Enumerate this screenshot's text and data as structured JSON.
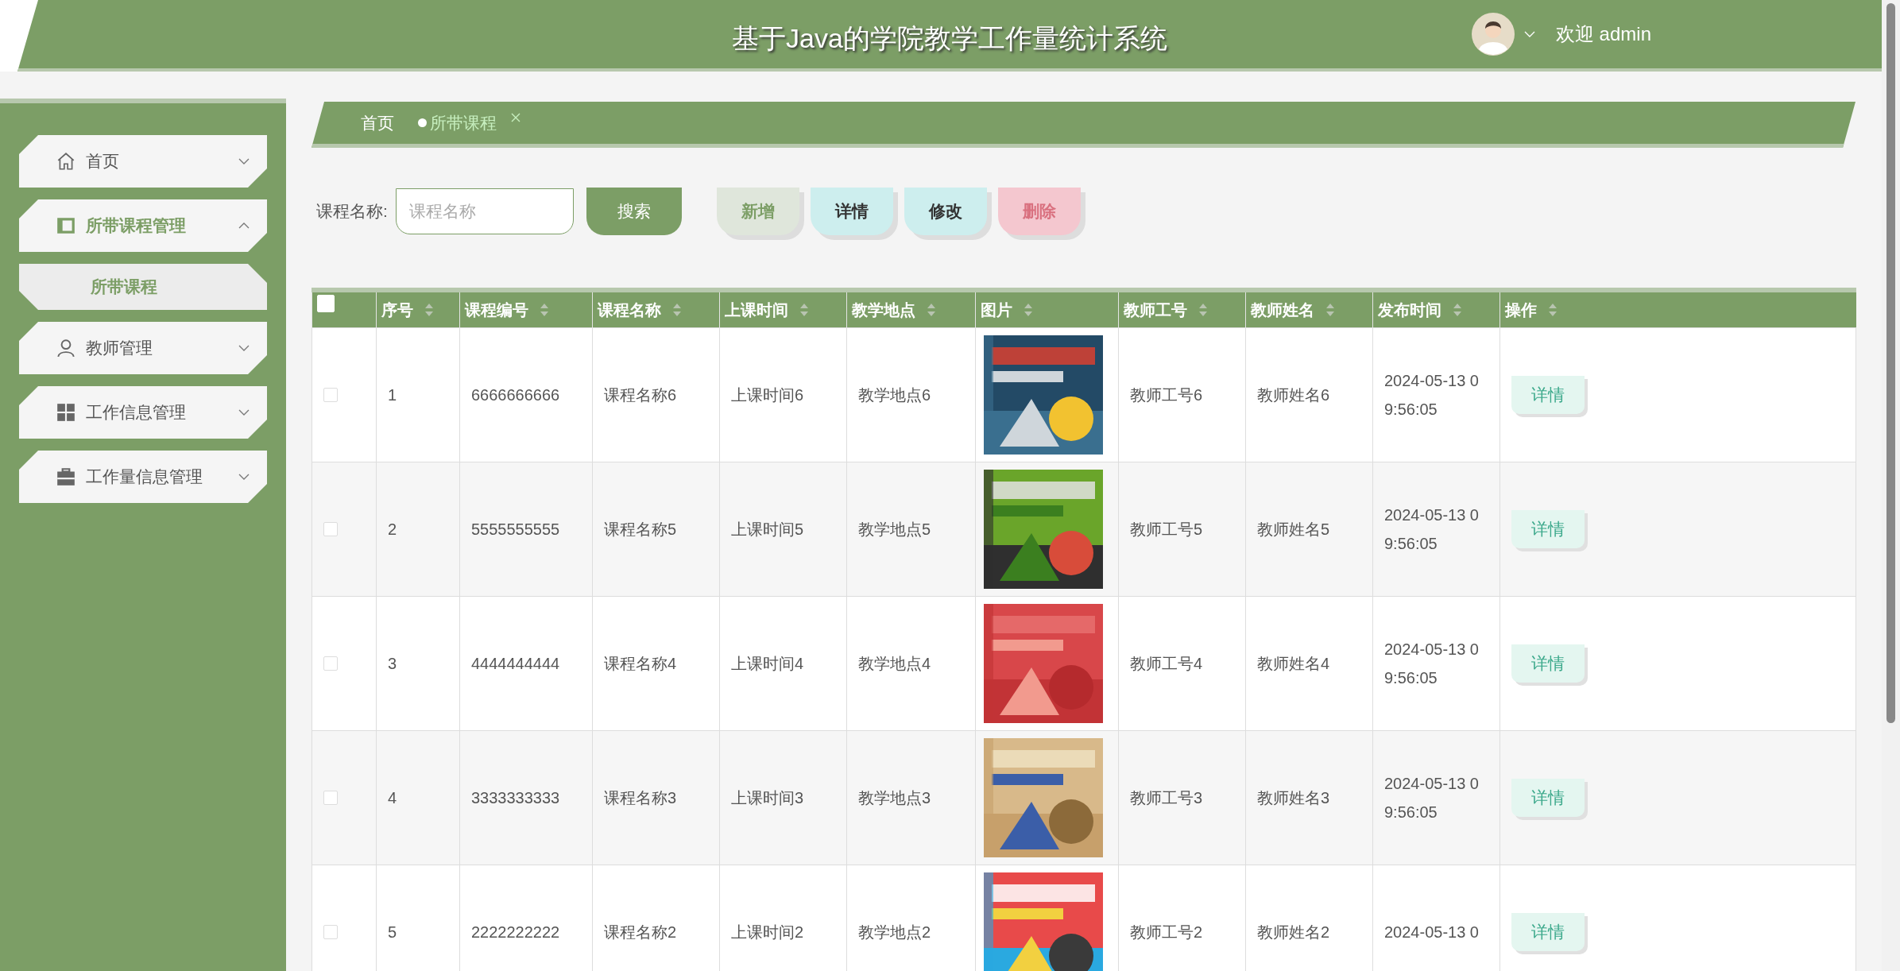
{
  "header": {
    "title": "基于Java的学院教学工作量统计系统",
    "welcome": "欢迎 admin"
  },
  "sidebar": {
    "items": [
      {
        "label": "首页",
        "kind": "home",
        "active": false,
        "expanded": false
      },
      {
        "label": "所带课程管理",
        "kind": "book",
        "active": true,
        "expanded": true,
        "children": [
          {
            "label": "所带课程",
            "selected": true
          }
        ]
      },
      {
        "label": "教师管理",
        "kind": "user",
        "active": false,
        "expanded": false
      },
      {
        "label": "工作信息管理",
        "kind": "grid",
        "active": false,
        "expanded": false
      },
      {
        "label": "工作量信息管理",
        "kind": "briefcase",
        "active": false,
        "expanded": false
      }
    ]
  },
  "tabs": [
    {
      "label": "首页",
      "selected": false,
      "closable": false
    },
    {
      "label": "所带课程",
      "selected": true,
      "closable": true
    }
  ],
  "search": {
    "label": "课程名称:",
    "placeholder": "课程名称",
    "button": "搜索"
  },
  "actions": [
    {
      "label": "新增",
      "kind": "add"
    },
    {
      "label": "详情",
      "kind": "detail"
    },
    {
      "label": "修改",
      "kind": "edit"
    },
    {
      "label": "删除",
      "kind": "delete"
    }
  ],
  "table": {
    "select_all_checked": false,
    "columns": [
      "序号",
      "课程编号",
      "课程名称",
      "上课时间",
      "教学地点",
      "图片",
      "教师工号",
      "教师姓名",
      "发布时间",
      "操作"
    ],
    "rows": [
      {
        "checked": false,
        "cells": [
          "1",
          "6666666666",
          "课程名称6",
          "上课时间6",
          "教学地点6"
        ],
        "picture": {
          "kind": "picture"
        },
        "cells2": [
          "教师工号6",
          "教师姓名6",
          "2024-05-13 09:56:05"
        ],
        "action": "详情"
      },
      {
        "checked": false,
        "cells": [
          "2",
          "5555555555",
          "课程名称5",
          "上课时间5",
          "教学地点5"
        ],
        "picture": {
          "kind": "picture"
        },
        "cells2": [
          "教师工号5",
          "教师姓名5",
          "2024-05-13 09:56:05"
        ],
        "action": "详情"
      },
      {
        "checked": false,
        "cells": [
          "3",
          "4444444444",
          "课程名称4",
          "上课时间4",
          "教学地点4"
        ],
        "picture": {
          "kind": "picture"
        },
        "cells2": [
          "教师工号4",
          "教师姓名4",
          "2024-05-13 09:56:05"
        ],
        "action": "详情"
      },
      {
        "checked": false,
        "cells": [
          "4",
          "3333333333",
          "课程名称3",
          "上课时间3",
          "教学地点3"
        ],
        "picture": {
          "kind": "picture"
        },
        "cells2": [
          "教师工号3",
          "教师姓名3",
          "2024-05-13 09:56:05"
        ],
        "action": "详情"
      },
      {
        "checked": false,
        "cells": [
          "5",
          "2222222222",
          "课程名称2",
          "上课时间2",
          "教学地点2"
        ],
        "picture": {
          "kind": "picture"
        },
        "cells2": [
          "教师工号2",
          "教师姓名2",
          "2024-05-13 0"
        ],
        "action": "详情"
      }
    ]
  }
}
